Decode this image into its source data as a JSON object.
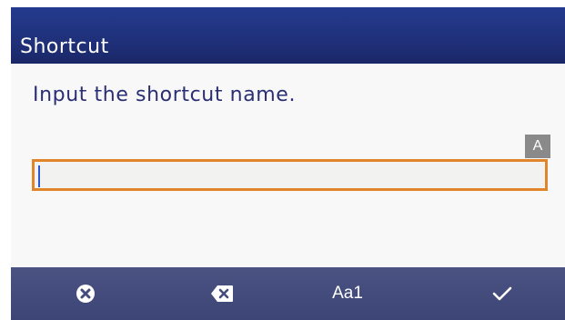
{
  "window": {
    "title": "Shortcut"
  },
  "dialog": {
    "prompt": "Input the shortcut name."
  },
  "input": {
    "value": "",
    "mode_badge": "A"
  },
  "toolbar": {
    "cancel_icon": "cancel-circle-x-icon",
    "backspace_icon": "backspace-icon",
    "char_mode_label": "Aa1",
    "ok_icon": "checkmark-icon"
  },
  "colors": {
    "title_bar": "#1f2f78",
    "toolbar": "#434c7c",
    "input_border": "#e0852a",
    "caret": "#2c58d8",
    "prompt_text": "#2a2f73"
  }
}
